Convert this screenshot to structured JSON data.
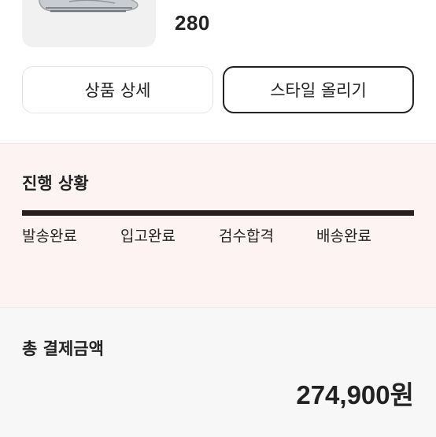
{
  "product": {
    "size": "280"
  },
  "actions": {
    "detail_label": "상품 상세",
    "style_label": "스타일 올리기"
  },
  "progress": {
    "title": "진행 상황",
    "completion": 1.0,
    "steps": [
      "발송완료",
      "입고완료",
      "검수합격",
      "배송완료"
    ]
  },
  "payment": {
    "label": "총 결제금액",
    "amount": "274,900원"
  },
  "colors": {
    "progress_bg": "#fdf3f2",
    "progress_fill": "#2a1f1f",
    "payment_bg": "#f7f7f8"
  }
}
